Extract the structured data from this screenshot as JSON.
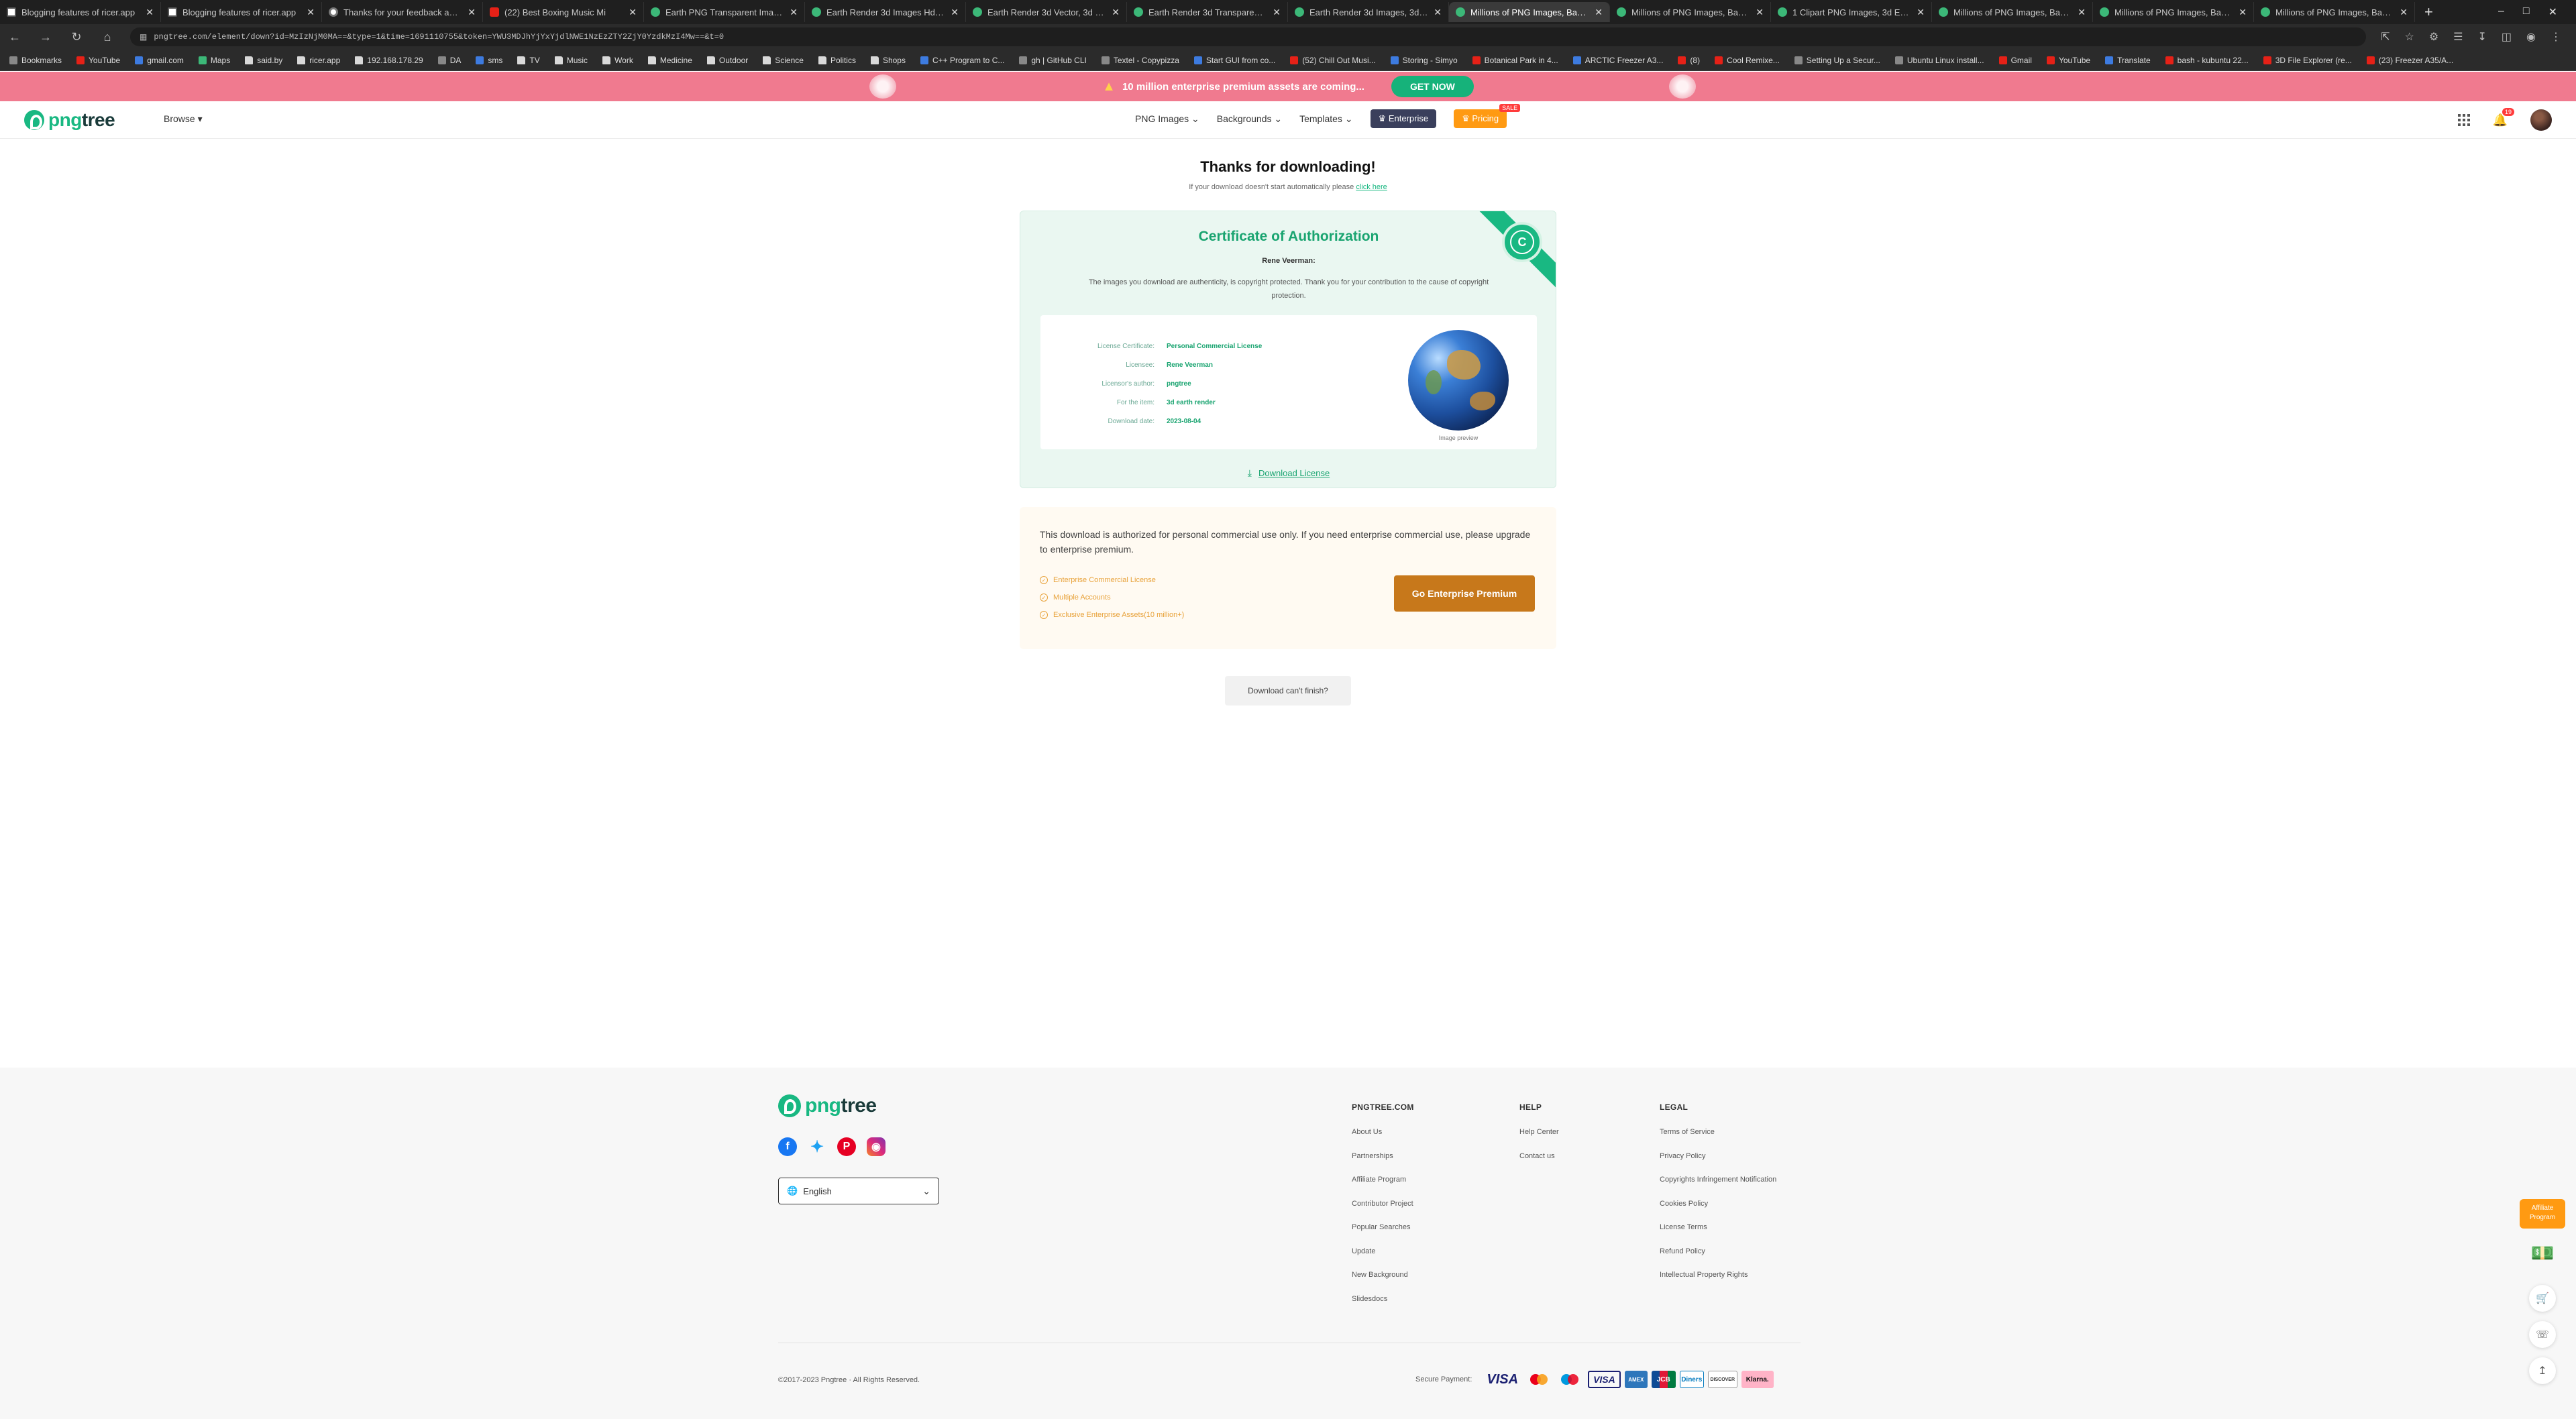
{
  "browser": {
    "tabs": [
      {
        "title": "Blogging features of ricer.app",
        "icon": "blog"
      },
      {
        "title": "Blogging features of ricer.app",
        "icon": "blog"
      },
      {
        "title": "Thanks for your feedback abou",
        "icon": "fb"
      },
      {
        "title": "(22) Best Boxing Music Mi",
        "icon": "yt"
      },
      {
        "title": "Earth PNG Transparent Images",
        "icon": "pngtree"
      },
      {
        "title": "Earth Render 3d Images Hd, 3c",
        "icon": "pngtree"
      },
      {
        "title": "Earth Render 3d Vector, 3d Ear",
        "icon": "pngtree"
      },
      {
        "title": "Earth Render 3d Transparent Pn",
        "icon": "pngtree"
      },
      {
        "title": "Earth Render 3d Images, 3d Ea",
        "icon": "pngtree"
      },
      {
        "title": "Millions of PNG Images, Backg",
        "icon": "pngtree",
        "active": true
      },
      {
        "title": "Millions of PNG Images, Backg",
        "icon": "pngtree"
      },
      {
        "title": "1 Clipart PNG Images, 3d Earth",
        "icon": "pngtree"
      },
      {
        "title": "Millions of PNG Images, Backg",
        "icon": "pngtree"
      },
      {
        "title": "Millions of PNG Images, Backg",
        "icon": "pngtree"
      },
      {
        "title": "Millions of PNG Images, Backg",
        "icon": "pngtree"
      }
    ],
    "url": "pngtree.com/element/down?id=MzIzNjM0MA==&type=1&time=1691110755&token=YWU3MDJhYjYxYjdlNWE1NzEzZTY2ZjY0YzdkMzI4Mw==&t=0",
    "bookmarks": [
      {
        "label": "Bookmarks",
        "icon": "star"
      },
      {
        "label": "YouTube",
        "icon": "red"
      },
      {
        "label": "gmail.com",
        "icon": "blue"
      },
      {
        "label": "Maps",
        "icon": "green"
      },
      {
        "label": "said.by",
        "icon": "folder"
      },
      {
        "label": "ricer.app",
        "icon": "folder"
      },
      {
        "label": "192.168.178.29",
        "icon": "folder"
      },
      {
        "label": "DA",
        "icon": "gray"
      },
      {
        "label": "sms",
        "icon": "blue"
      },
      {
        "label": "TV",
        "icon": "folder"
      },
      {
        "label": "Music",
        "icon": "folder"
      },
      {
        "label": "Work",
        "icon": "folder"
      },
      {
        "label": "Medicine",
        "icon": "folder"
      },
      {
        "label": "Outdoor",
        "icon": "folder"
      },
      {
        "label": "Science",
        "icon": "folder"
      },
      {
        "label": "Politics",
        "icon": "folder"
      },
      {
        "label": "Shops",
        "icon": "folder"
      },
      {
        "label": "C++ Program to C...",
        "icon": "blue"
      },
      {
        "label": "gh | GitHub CLI",
        "icon": "gray"
      },
      {
        "label": "Textel - Copypizza",
        "icon": "gray"
      },
      {
        "label": "Start GUI from co...",
        "icon": "blue"
      },
      {
        "label": "(52) Chill Out Musi...",
        "icon": "red"
      },
      {
        "label": "Storing - Simyo",
        "icon": "blue"
      },
      {
        "label": "Botanical Park in 4...",
        "icon": "red"
      },
      {
        "label": "ARCTIC Freezer A3...",
        "icon": "blue"
      },
      {
        "label": "(8)",
        "icon": "red"
      },
      {
        "label": "Cool Remixe...",
        "icon": "red"
      },
      {
        "label": "Setting Up a Secur...",
        "icon": "gray"
      },
      {
        "label": "Ubuntu Linux install...",
        "icon": "gray"
      },
      {
        "label": "Gmail",
        "icon": "red"
      },
      {
        "label": "YouTube",
        "icon": "red"
      },
      {
        "label": "Translate",
        "icon": "blue"
      },
      {
        "label": "bash - kubuntu 22...",
        "icon": "red"
      },
      {
        "label": "3D File Explorer (re...",
        "icon": "red"
      },
      {
        "label": "(23) Freezer A35/A...",
        "icon": "red"
      }
    ]
  },
  "promo": {
    "text": "10  million  enterprise  premium  assets  are  coming...",
    "button": "GET  NOW"
  },
  "header": {
    "logo_png": "png",
    "logo_tree": "tree",
    "browse": "Browse ▾",
    "nav": {
      "png_images": "PNG  Images",
      "backgrounds": "Backgrounds",
      "templates": "Templates",
      "enterprise": "Enterprise",
      "pricing": "Pricing",
      "sale": "SALE"
    },
    "notifications_count": "19"
  },
  "main": {
    "title": "Thanks  for  downloading!",
    "subtitle": "If your download doesn't start automatically please",
    "subtitle_link": "click here",
    "certificate": {
      "title": "Certificate  of  Authorization",
      "seal_letter": "C",
      "holder": "Rene  Veerman:",
      "description": "The images you download are authenticity, is copyright protected. Thank you for your contribution to the cause of copyright protection.",
      "fields": [
        {
          "label": "License Certificate:",
          "value": "Personal  Commercial  License"
        },
        {
          "label": "Licensee:",
          "value": "Rene  Veerman"
        },
        {
          "label": "Licensor's author:",
          "value": "pngtree"
        },
        {
          "label": "For the item:",
          "value": "3d  earth  render"
        },
        {
          "label": "Download date:",
          "value": "2023-08-04"
        }
      ],
      "preview_caption": "Image preview",
      "download_license": "Download  License"
    },
    "upsell": {
      "text": "This download is authorized for personal commercial use only. If you need enterprise commercial use, please upgrade to enterprise premium.",
      "items": [
        "Enterprise  Commercial  License",
        "Multiple  Accounts",
        "Exclusive  Enterprise  Assets(10 million+)"
      ],
      "button": "Go  Enterprise  Premium"
    },
    "cant_finish": "Download can't finish?"
  },
  "footer": {
    "language": "English",
    "columns": [
      {
        "title": "PNGTREE.COM",
        "links": [
          "About Us",
          "Partnerships",
          "Affiliate Program",
          "Contributor Project",
          "Popular Searches",
          "Update",
          "New Background",
          "Slidesdocs"
        ]
      },
      {
        "title": "HELP",
        "links": [
          "Help Center",
          "Contact us"
        ]
      },
      {
        "title": "LEGAL",
        "links": [
          "Terms of Service",
          "Privacy Policy",
          "Copyrights Infringement Notification",
          "Cookies Policy",
          "License Terms",
          "Refund Policy",
          "Intellectual Property Rights"
        ]
      }
    ],
    "copyright": "©2017-2023 Pngtree  · All Rights Reserved.",
    "secure_payment": "Secure Payment:",
    "payment_methods": [
      "VISA",
      "Mastercard",
      "Maestro",
      "VISA",
      "AMEX",
      "JCB",
      "Diners",
      "DISCOVER",
      "Klarna."
    ]
  },
  "floating": {
    "affiliate": "Affiliate Program"
  }
}
